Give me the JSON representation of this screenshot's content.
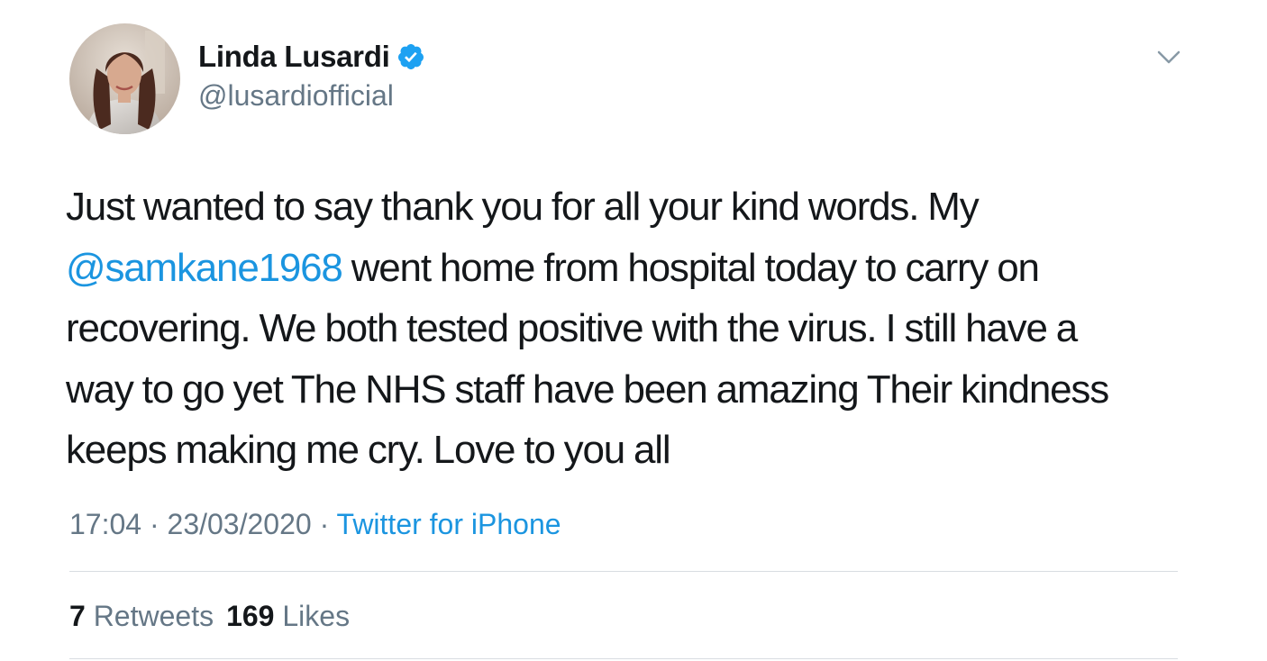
{
  "user": {
    "display_name": "Linda Lusardi",
    "handle": "@lusardiofficial",
    "verified": true,
    "avatar_icon": "profile-photo"
  },
  "tweet": {
    "lines": [
      {
        "segments": [
          {
            "text": "Just wanted to say thank you for all your kind words. My",
            "type": "text"
          }
        ]
      },
      {
        "segments": [
          {
            "text": "@samkane1968",
            "type": "mention"
          },
          {
            "text": " went home from hospital today to carry on",
            "type": "text"
          }
        ]
      },
      {
        "segments": [
          {
            "text": "recovering. We both tested positive with the virus. I still have a",
            "type": "text"
          }
        ]
      },
      {
        "segments": [
          {
            "text": "way to go yet The NHS staff have been amazing Their kindness",
            "type": "text"
          }
        ]
      },
      {
        "segments": [
          {
            "text": "keeps making me cry. Love to you all",
            "type": "text"
          }
        ]
      }
    ]
  },
  "meta": {
    "time": "17:04",
    "separator": " · ",
    "date": "23/03/2020",
    "source": "Twitter for iPhone"
  },
  "stats": {
    "retweets_count": "7",
    "retweets_label": "Retweets",
    "likes_count": "169",
    "likes_label": "Likes"
  },
  "colors": {
    "accent": "#1b95e0",
    "verified_badge": "#1da1f2",
    "secondary_text": "#657786",
    "primary_text": "#14171a",
    "divider": "#d8dde2"
  },
  "icons": {
    "verified": "verified-badge-icon",
    "menu": "chevron-down-icon"
  }
}
